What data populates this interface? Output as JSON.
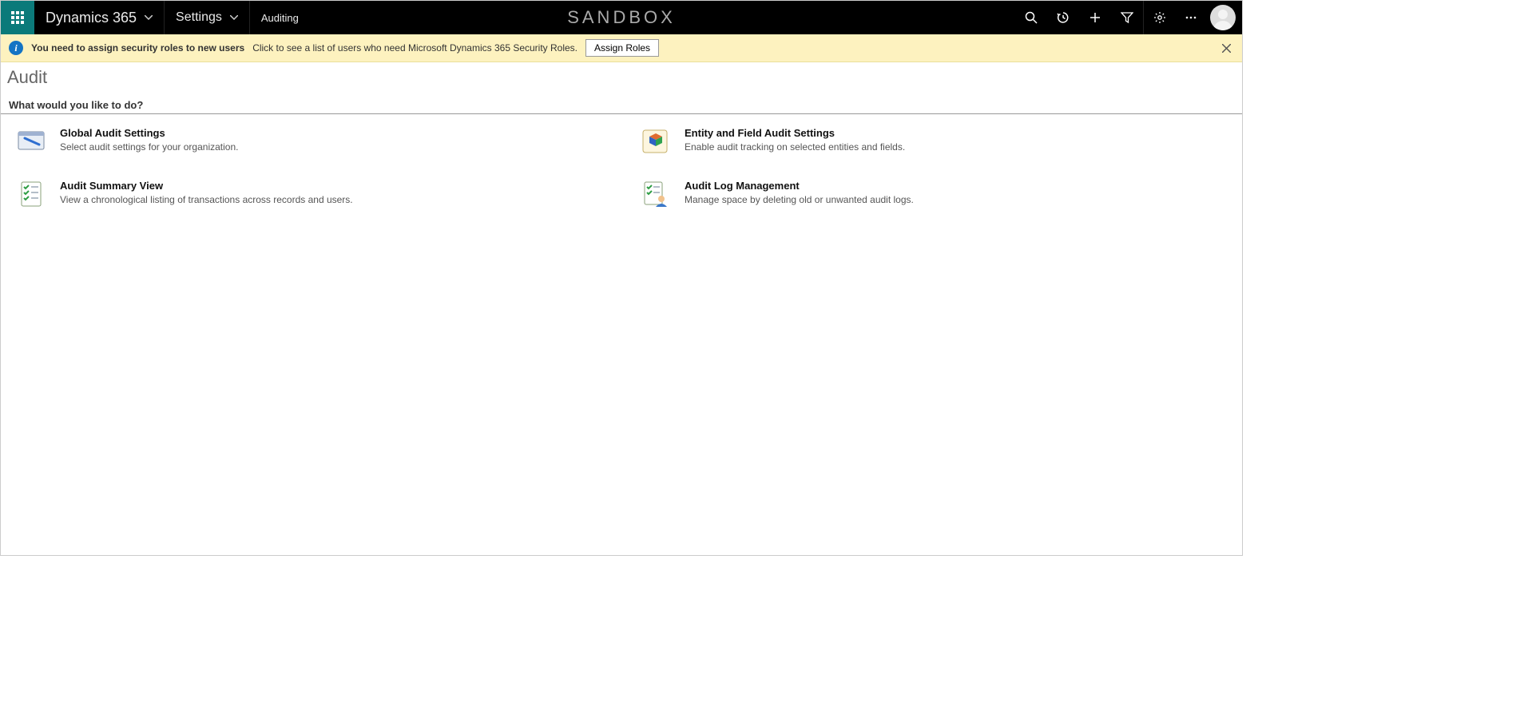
{
  "nav": {
    "app_label": "Dynamics 365",
    "area_label": "Settings",
    "sub_area_label": "Auditing",
    "env_label": "SANDBOX"
  },
  "notification": {
    "bold_text": "You need to assign security roles to new users",
    "message": "Click to see a list of users who need Microsoft Dynamics 365 Security Roles.",
    "button_label": "Assign Roles"
  },
  "page": {
    "title": "Audit",
    "section_title": "What would you like to do?"
  },
  "tiles": [
    {
      "title": "Global Audit Settings",
      "desc": "Select audit settings for your organization."
    },
    {
      "title": "Entity and Field Audit Settings",
      "desc": "Enable audit tracking on selected entities and fields."
    },
    {
      "title": "Audit Summary View",
      "desc": "View a chronological listing of transactions across records and users."
    },
    {
      "title": "Audit Log Management",
      "desc": "Manage space by deleting old or unwanted audit logs."
    }
  ]
}
